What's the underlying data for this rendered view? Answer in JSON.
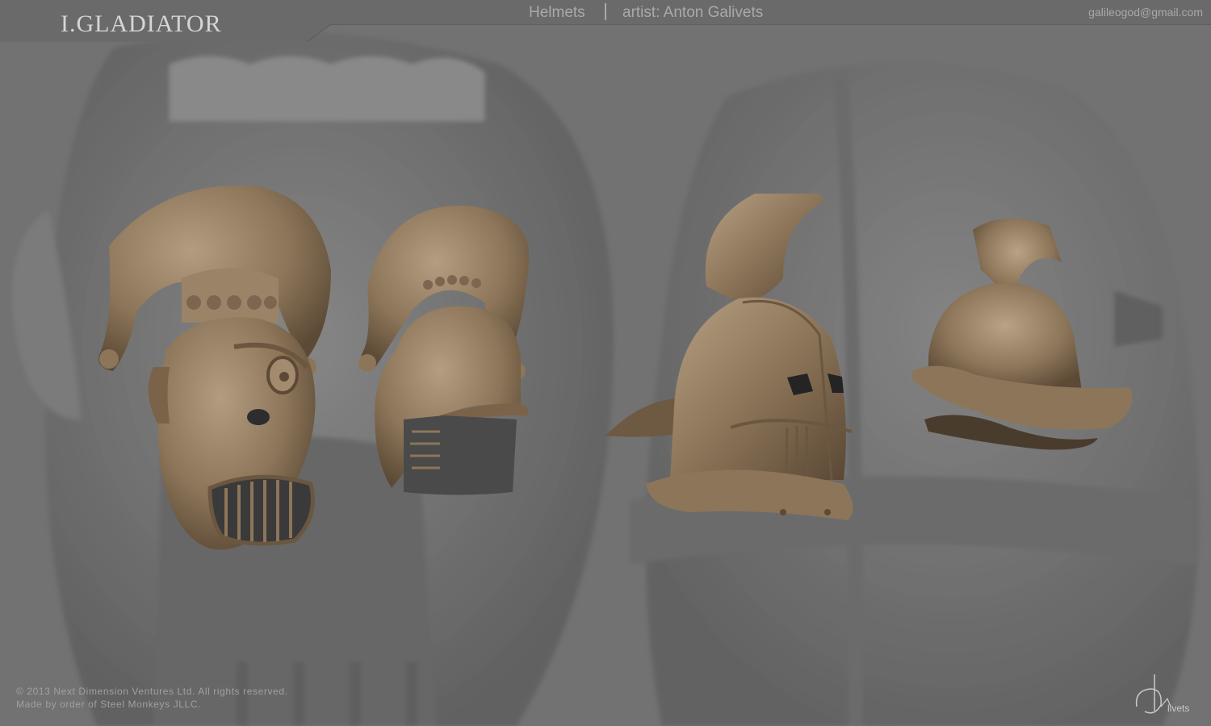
{
  "header": {
    "title": "I.GLADIATOR",
    "section": "Helmets",
    "artist": "artist: Anton Galivets",
    "email": "galileogod@gmail.com"
  },
  "footer": {
    "copyright": "© 2013 Next Dimension Ventures Ltd. All rights reserved.",
    "made_by": "Made by order of Steel Monkeys JLLC.",
    "signature": "Galivets"
  },
  "colors": {
    "background": "#727272",
    "helmet_bronze": "#8c7559",
    "header_text": "#a9a9a9",
    "title_text": "#d6d6d6"
  },
  "artworks": [
    {
      "name": "cyclops-mask-helmet-front",
      "view": "front"
    },
    {
      "name": "cyclops-mask-helmet-side",
      "view": "side"
    },
    {
      "name": "visored-crest-helmet",
      "view": "front-three-quarter"
    },
    {
      "name": "crested-brimmed-helmet",
      "view": "side"
    }
  ]
}
